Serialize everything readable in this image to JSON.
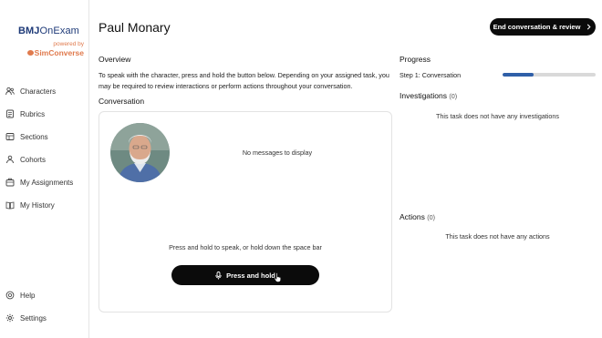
{
  "brand": {
    "name_bold": "BMJ",
    "name_light": "OnExam",
    "powered_by": "powered by",
    "partner": "SimConverse"
  },
  "sidebar": {
    "items": [
      {
        "label": "Characters",
        "icon": "people-icon"
      },
      {
        "label": "Rubrics",
        "icon": "rubric-icon"
      },
      {
        "label": "Sections",
        "icon": "sections-icon"
      },
      {
        "label": "Cohorts",
        "icon": "cohorts-icon"
      },
      {
        "label": "My Assignments",
        "icon": "assignments-icon"
      },
      {
        "label": "My History",
        "icon": "history-icon"
      }
    ],
    "bottom": [
      {
        "label": "Help",
        "icon": "help-icon"
      },
      {
        "label": "Settings",
        "icon": "gear-icon"
      }
    ]
  },
  "header": {
    "title": "Paul Monary",
    "end_button": "End conversation & review"
  },
  "overview": {
    "heading": "Overview",
    "text": "To speak with the character, press and hold the button below. Depending on your assigned task, you may be required to review interactions or perform actions throughout your conversation."
  },
  "conversation": {
    "heading": "Conversation",
    "empty": "No messages to display",
    "hint": "Press and hold to speak, or hold down the space bar",
    "button": "Press and hold"
  },
  "progress": {
    "heading": "Progress",
    "step": "Step 1: Conversation",
    "fraction": 0.33
  },
  "investigations": {
    "heading": "Investigations",
    "count": "(0)",
    "empty": "This task does not have any investigations"
  },
  "actions": {
    "heading": "Actions",
    "count": "(0)",
    "empty": "This task does not have any actions"
  },
  "colors": {
    "accent": "#2f5fa8",
    "brand_blue": "#1e3a78",
    "brand_orange": "#e07a4d",
    "button": "#0b0b0b"
  }
}
